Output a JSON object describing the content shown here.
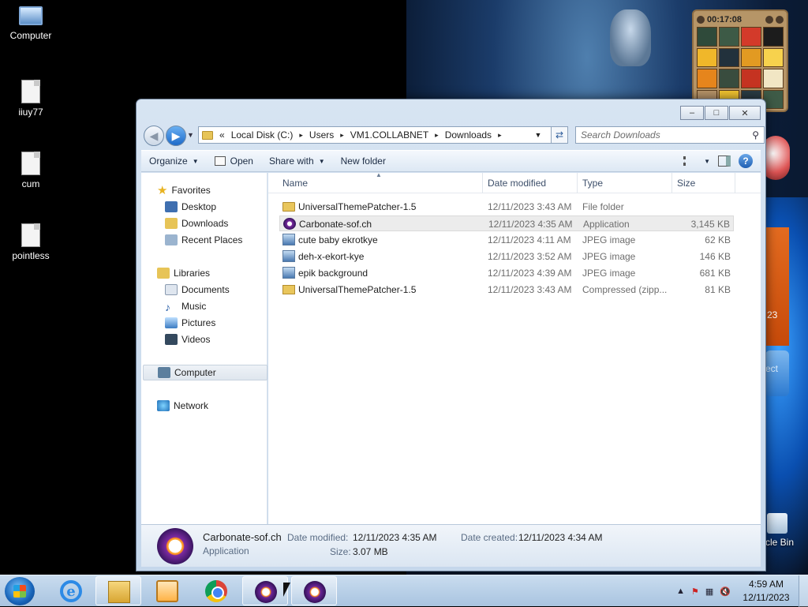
{
  "desktop": {
    "icons": [
      {
        "label": "Computer",
        "icon": "computer-icon"
      },
      {
        "label": "iiuy77",
        "icon": "document-icon"
      },
      {
        "label": "cum",
        "icon": "document-icon"
      },
      {
        "label": "pointless",
        "icon": "document-icon"
      }
    ],
    "puzzle_timer": "00:17:08",
    "calendar_partial": "23",
    "gadget_partial": "ect",
    "recycle_partial": "cle Bin"
  },
  "window": {
    "controls": {
      "minimize": "–",
      "maximize": "□",
      "close": "✕"
    },
    "address": {
      "prefix": "«",
      "crumbs": [
        "Local Disk (C:)",
        "Users",
        "VM1.COLLABNET",
        "Downloads"
      ],
      "sep": "▸"
    },
    "search_placeholder": "Search Downloads",
    "toolbar": {
      "organize": "Organize",
      "open": "Open",
      "share": "Share with",
      "new_folder": "New folder",
      "help": "?"
    },
    "nav": {
      "favorites": "Favorites",
      "favorites_items": [
        "Desktop",
        "Downloads",
        "Recent Places"
      ],
      "libraries": "Libraries",
      "libraries_items": [
        "Documents",
        "Music",
        "Pictures",
        "Videos"
      ],
      "computer": "Computer",
      "network": "Network"
    },
    "columns": {
      "name": "Name",
      "date": "Date modified",
      "type": "Type",
      "size": "Size"
    },
    "files": [
      {
        "name": "UniversalThemePatcher-1.5",
        "date": "12/11/2023 3:43 AM",
        "type": "File folder",
        "size": "",
        "kind": "folder"
      },
      {
        "name": "Carbonate-sof.ch",
        "date": "12/11/2023 4:35 AM",
        "type": "Application",
        "size": "3,145 KB",
        "kind": "app"
      },
      {
        "name": "cute baby ekrotkye",
        "date": "12/11/2023 4:11 AM",
        "type": "JPEG image",
        "size": "62 KB",
        "kind": "image"
      },
      {
        "name": "deh-x-ekort-kye",
        "date": "12/11/2023 3:52 AM",
        "type": "JPEG image",
        "size": "146 KB",
        "kind": "image"
      },
      {
        "name": "epik background",
        "date": "12/11/2023 4:39 AM",
        "type": "JPEG image",
        "size": "681 KB",
        "kind": "image"
      },
      {
        "name": "UniversalThemePatcher-1.5",
        "date": "12/11/2023 3:43 AM",
        "type": "Compressed (zipp...",
        "size": "81 KB",
        "kind": "zip"
      }
    ],
    "details": {
      "name": "Carbonate-sof.ch",
      "type": "Application",
      "modified_label": "Date modified:",
      "modified": "12/11/2023 4:35 AM",
      "created_label": "Date created:",
      "created": "12/11/2023 4:34 AM",
      "size_label": "Size:",
      "size": "3.07 MB"
    }
  },
  "taskbar": {
    "time": "4:59 AM",
    "date": "12/11/2023",
    "apps": [
      "internet-explorer",
      "windows-explorer",
      "media-player",
      "chrome",
      "carbonate",
      "carbonate"
    ]
  }
}
